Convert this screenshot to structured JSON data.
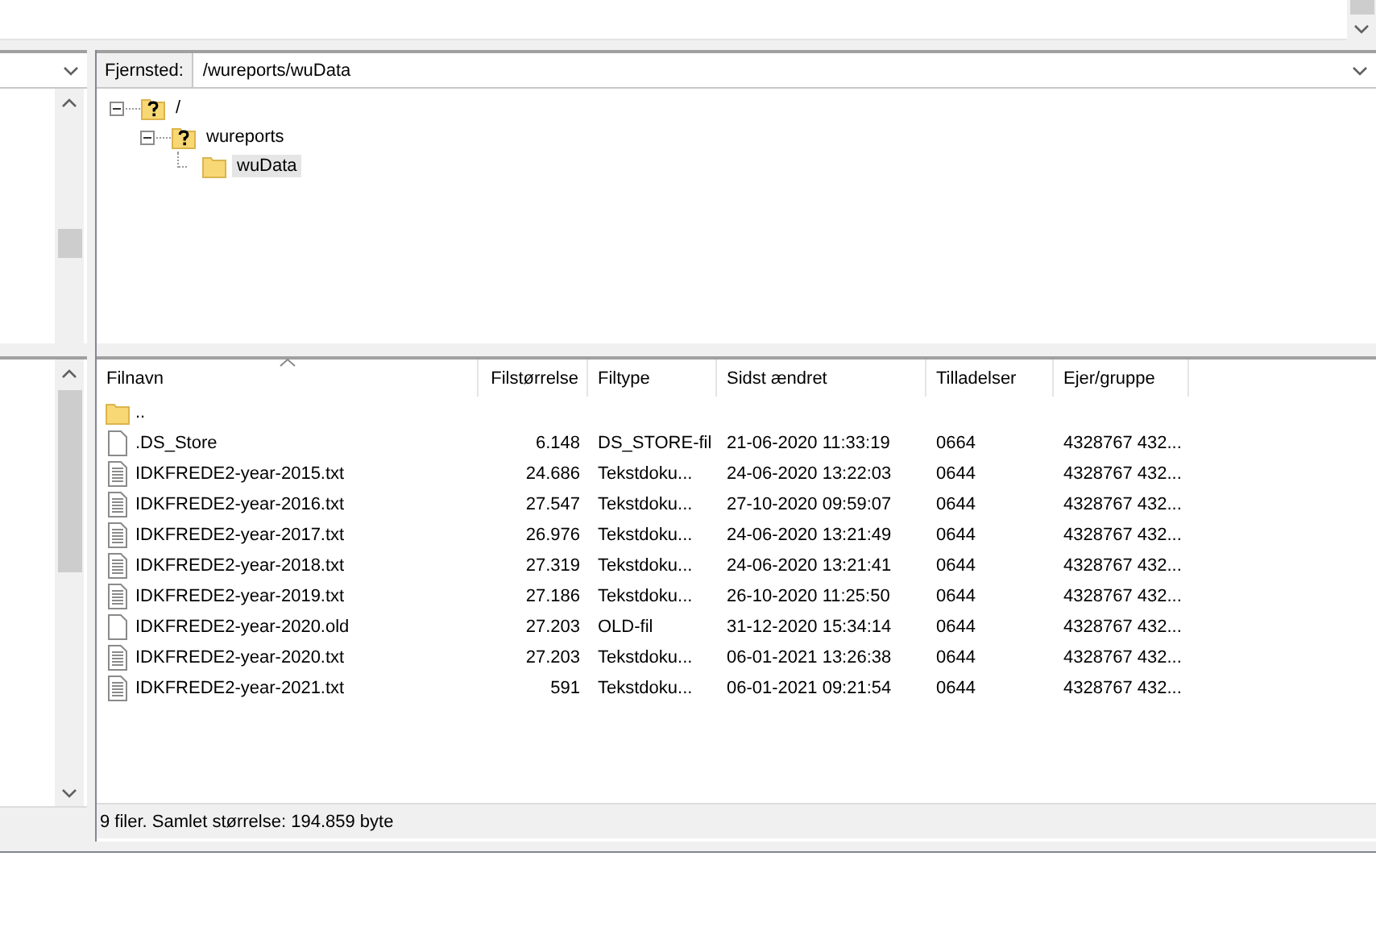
{
  "remote_site": {
    "label": "Fjernsted:",
    "path": "/wureports/wuData",
    "tree": [
      {
        "name": "/",
        "kind": "unknown",
        "expanded": true,
        "selected": false,
        "children": [
          {
            "name": "wureports",
            "kind": "unknown",
            "expanded": true,
            "selected": false,
            "children": [
              {
                "name": "wuData",
                "kind": "folder",
                "selected": true
              }
            ]
          }
        ]
      }
    ]
  },
  "file_list": {
    "columns": [
      {
        "label": "Filnavn",
        "sorted": true
      },
      {
        "label": "Filstørrelse",
        "sorted": false
      },
      {
        "label": "Filtype",
        "sorted": false
      },
      {
        "label": "Sidst ændret",
        "sorted": false
      },
      {
        "label": "Tilladelser",
        "sorted": false
      },
      {
        "label": "Ejer/gruppe",
        "sorted": false
      }
    ],
    "rows": [
      {
        "kind": "folder",
        "name": ".."
      },
      {
        "kind": "file",
        "name": ".DS_Store",
        "size": "6.148",
        "type": "DS_STORE-fil",
        "modified": "21-06-2020 11:33:19",
        "permissions": "0664",
        "owner": "4328767 432..."
      },
      {
        "kind": "text",
        "name": "IDKFREDE2-year-2015.txt",
        "size": "24.686",
        "type": "Tekstdoku...",
        "modified": "24-06-2020 13:22:03",
        "permissions": "0644",
        "owner": "4328767 432..."
      },
      {
        "kind": "text",
        "name": "IDKFREDE2-year-2016.txt",
        "size": "27.547",
        "type": "Tekstdoku...",
        "modified": "27-10-2020 09:59:07",
        "permissions": "0644",
        "owner": "4328767 432..."
      },
      {
        "kind": "text",
        "name": "IDKFREDE2-year-2017.txt",
        "size": "26.976",
        "type": "Tekstdoku...",
        "modified": "24-06-2020 13:21:49",
        "permissions": "0644",
        "owner": "4328767 432..."
      },
      {
        "kind": "text",
        "name": "IDKFREDE2-year-2018.txt",
        "size": "27.319",
        "type": "Tekstdoku...",
        "modified": "24-06-2020 13:21:41",
        "permissions": "0644",
        "owner": "4328767 432..."
      },
      {
        "kind": "text",
        "name": "IDKFREDE2-year-2019.txt",
        "size": "27.186",
        "type": "Tekstdoku...",
        "modified": "26-10-2020 11:25:50",
        "permissions": "0644",
        "owner": "4328767 432..."
      },
      {
        "kind": "file",
        "name": "IDKFREDE2-year-2020.old",
        "size": "27.203",
        "type": "OLD-fil",
        "modified": "31-12-2020 15:34:14",
        "permissions": "0644",
        "owner": "4328767 432..."
      },
      {
        "kind": "text",
        "name": "IDKFREDE2-year-2020.txt",
        "size": "27.203",
        "type": "Tekstdoku...",
        "modified": "06-01-2021 13:26:38",
        "permissions": "0644",
        "owner": "4328767 432..."
      },
      {
        "kind": "text",
        "name": "IDKFREDE2-year-2021.txt",
        "size": "591",
        "type": "Tekstdoku...",
        "modified": "06-01-2021 09:21:54",
        "permissions": "0644",
        "owner": "4328767 432..."
      }
    ]
  },
  "status_bar": "9 filer. Samlet størrelse: 194.859 byte"
}
